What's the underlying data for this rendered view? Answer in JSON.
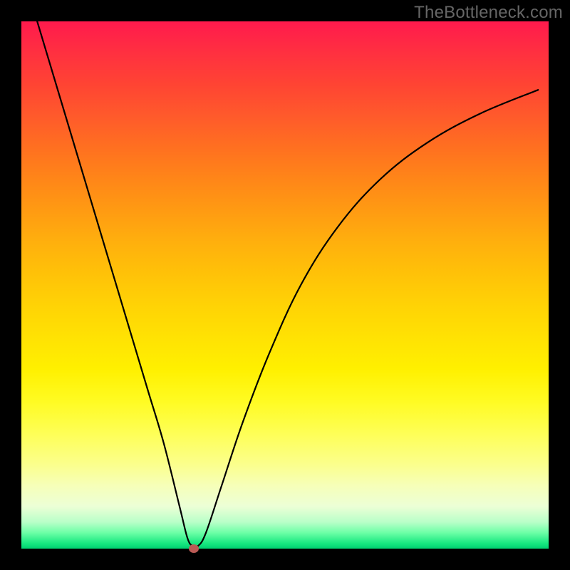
{
  "watermark": "TheBottleneck.com",
  "chart_data": {
    "type": "line",
    "title": "",
    "xlabel": "",
    "ylabel": "",
    "xlim": [
      0,
      100
    ],
    "ylim": [
      0,
      100
    ],
    "grid": false,
    "series": [
      {
        "name": "bottleneck-curve",
        "x": [
          3,
          6,
          9,
          12,
          15,
          18,
          21,
          24,
          27,
          30,
          31.5,
          32.5,
          33.5,
          35,
          38,
          42,
          47,
          53,
          60,
          68,
          77,
          87,
          98
        ],
        "y": [
          100,
          90,
          80,
          70,
          60,
          50,
          40,
          30,
          20,
          8,
          2,
          0.5,
          0.5,
          3,
          12,
          24,
          37,
          50,
          61,
          70,
          77,
          82.5,
          87
        ]
      }
    ],
    "marker": {
      "x": 32.7,
      "y": 0
    },
    "background_gradient": {
      "top": "#ff1a4d",
      "mid": "#ffe600",
      "bottom": "#00d070"
    }
  }
}
